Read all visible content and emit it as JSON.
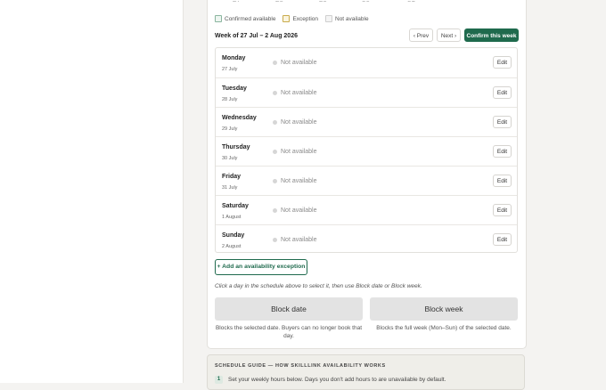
{
  "calendar": {
    "visible_days": [
      "27",
      "28",
      "29",
      "30",
      "31"
    ]
  },
  "legend": [
    {
      "label": "Confirmed available",
      "kind": "confirmed"
    },
    {
      "label": "Exception",
      "kind": "exception"
    },
    {
      "label": "Not available",
      "kind": "na"
    }
  ],
  "week": {
    "label": "Week of 27 Jul – 2 Aug 2026",
    "prev_label": "‹ Prev",
    "next_label": "Next ›",
    "confirm_label": "Confirm this week"
  },
  "days": [
    {
      "name": "Monday",
      "date": "27 July",
      "status": "Not available",
      "edit": "Edit"
    },
    {
      "name": "Tuesday",
      "date": "28 July",
      "status": "Not available",
      "edit": "Edit"
    },
    {
      "name": "Wednesday",
      "date": "29 July",
      "status": "Not available",
      "edit": "Edit"
    },
    {
      "name": "Thursday",
      "date": "30 July",
      "status": "Not available",
      "edit": "Edit"
    },
    {
      "name": "Friday",
      "date": "31 July",
      "status": "Not available",
      "edit": "Edit"
    },
    {
      "name": "Saturday",
      "date": "1 August",
      "status": "Not available",
      "edit": "Edit"
    },
    {
      "name": "Sunday",
      "date": "2 August",
      "status": "Not available",
      "edit": "Edit"
    }
  ],
  "actions": {
    "add_exception": "+ Add an availability exception",
    "hint": "Click a day in the schedule above to select it, then use Block date or Block week.",
    "block_date": "Block date",
    "block_date_desc": "Blocks the selected date. Buyers can no longer book that day.",
    "block_week": "Block week",
    "block_week_desc": "Blocks the full week (Mon–Sun) of the selected date."
  },
  "guide": {
    "title": "SCHEDULE GUIDE — HOW SKILLLINK AVAILABILITY WORKS",
    "steps": [
      {
        "num": "1",
        "text": "Set your weekly hours below. Days you don't add hours to are unavailable by default."
      }
    ]
  },
  "colors": {
    "accent": "#1f6a4d",
    "exception": "#c9ab4c",
    "muted": "#8a8a8a"
  }
}
